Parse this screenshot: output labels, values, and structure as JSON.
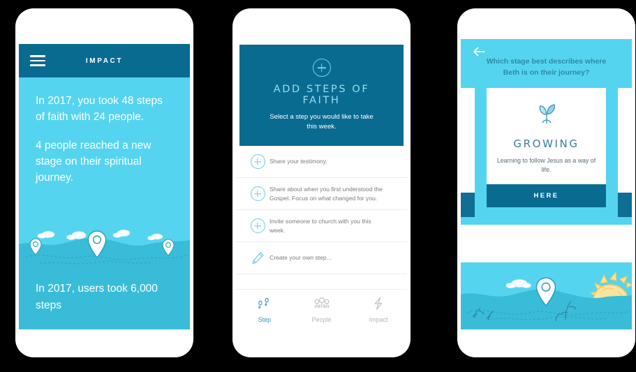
{
  "colors": {
    "dark_teal": "#0a6b91",
    "light_cyan": "#55d4f0",
    "mid_teal": "#39bcd8",
    "accent_pale": "#9adcf2",
    "gray_text": "#7b7b7b",
    "background": "#000000"
  },
  "phone1": {
    "header": {
      "title": "IMPACT",
      "menu_icon": "hamburger-icon"
    },
    "paragraphs": [
      "In 2017, you took 48 steps of faith with 24 people.",
      "4 people reached a new stage on their spiritual journey."
    ],
    "footer_text": "In 2017, users took 6,000 steps",
    "scene": {
      "pins": 3,
      "clouds": 3,
      "description": "rolling-hills-with-map-pins"
    }
  },
  "phone2": {
    "hero": {
      "icon": "plus-circle-icon",
      "title": "ADD STEPS OF FAITH",
      "subtitle": "Select a step you would like to take this week."
    },
    "steps": [
      {
        "icon": "plus-circle-icon",
        "text": "Share your testimony."
      },
      {
        "icon": "plus-circle-icon",
        "text": "Share about when you first understood the Gospel. Focus on what changed for you."
      },
      {
        "icon": "plus-circle-icon",
        "text": "Invite someone  to church with you this week."
      },
      {
        "icon": "pencil-icon",
        "text": "Create your own step…"
      }
    ],
    "tabs": [
      {
        "label": "Step",
        "icon": "footsteps-icon",
        "active": true
      },
      {
        "label": "People",
        "icon": "people-icon",
        "active": false
      },
      {
        "label": "Impact",
        "icon": "lightning-bolt-icon",
        "active": false
      }
    ]
  },
  "phone3": {
    "back_icon": "back-arrow-icon",
    "question": "Which stage best describes where Beth is on their journey?",
    "card": {
      "icon": "seedling-icon",
      "title": "GROWING",
      "description": "Learning to follow Jesus as a way of life.",
      "button_label": "HERE"
    },
    "scene": {
      "description": "hills-with-sun-cloud-and-map-pin",
      "sun": true,
      "clouds": 1,
      "pins": 1
    }
  }
}
